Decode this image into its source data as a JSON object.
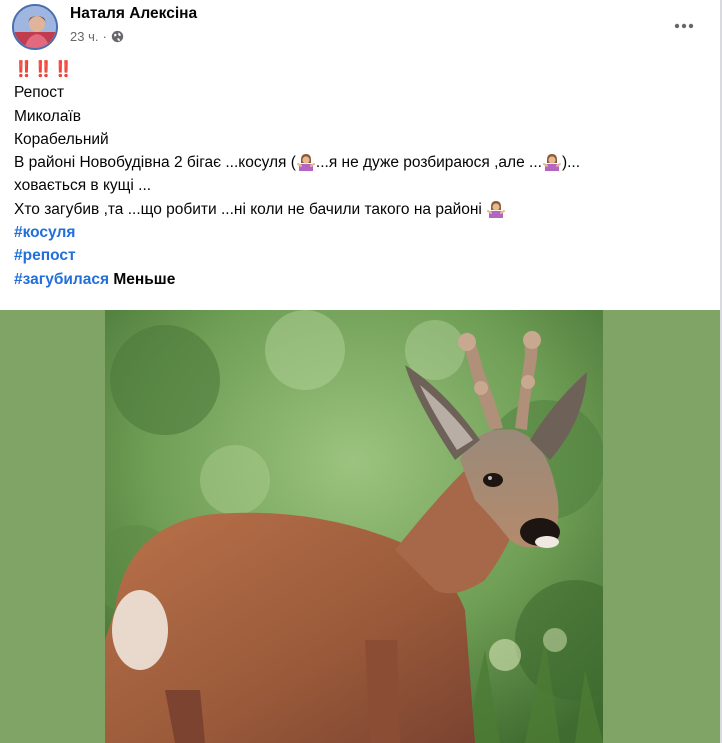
{
  "post": {
    "author_name": "Наталя Алексіна",
    "time_ago": "23 ч.",
    "meta_separator": "·",
    "audience_icon": "globe-icon",
    "menu_icon": "more-options-icon",
    "alert_marks": "‼️‼️‼️",
    "lines": {
      "repost": "Репост",
      "city": "Миколаїв",
      "district": "Корабельний",
      "line4_a": "В районі  Новобудівна 2 бігає ...косуля (",
      "line4_b": "...я не дуже розбираюся ,але ...",
      "line4_c": ")...",
      "line5": "ховається в кущі ...",
      "line6": "Хто загубив ,та ...що робити ...ні коли не бачили такого на районі "
    },
    "emoji_icon": "shrug-woman-icon",
    "hashtags": [
      "#косуля",
      "#репост",
      "#загубилася"
    ],
    "see_less_label": "Меньше"
  },
  "photo": {
    "subject": "roe deer buck",
    "background_color": "#7fa466"
  }
}
